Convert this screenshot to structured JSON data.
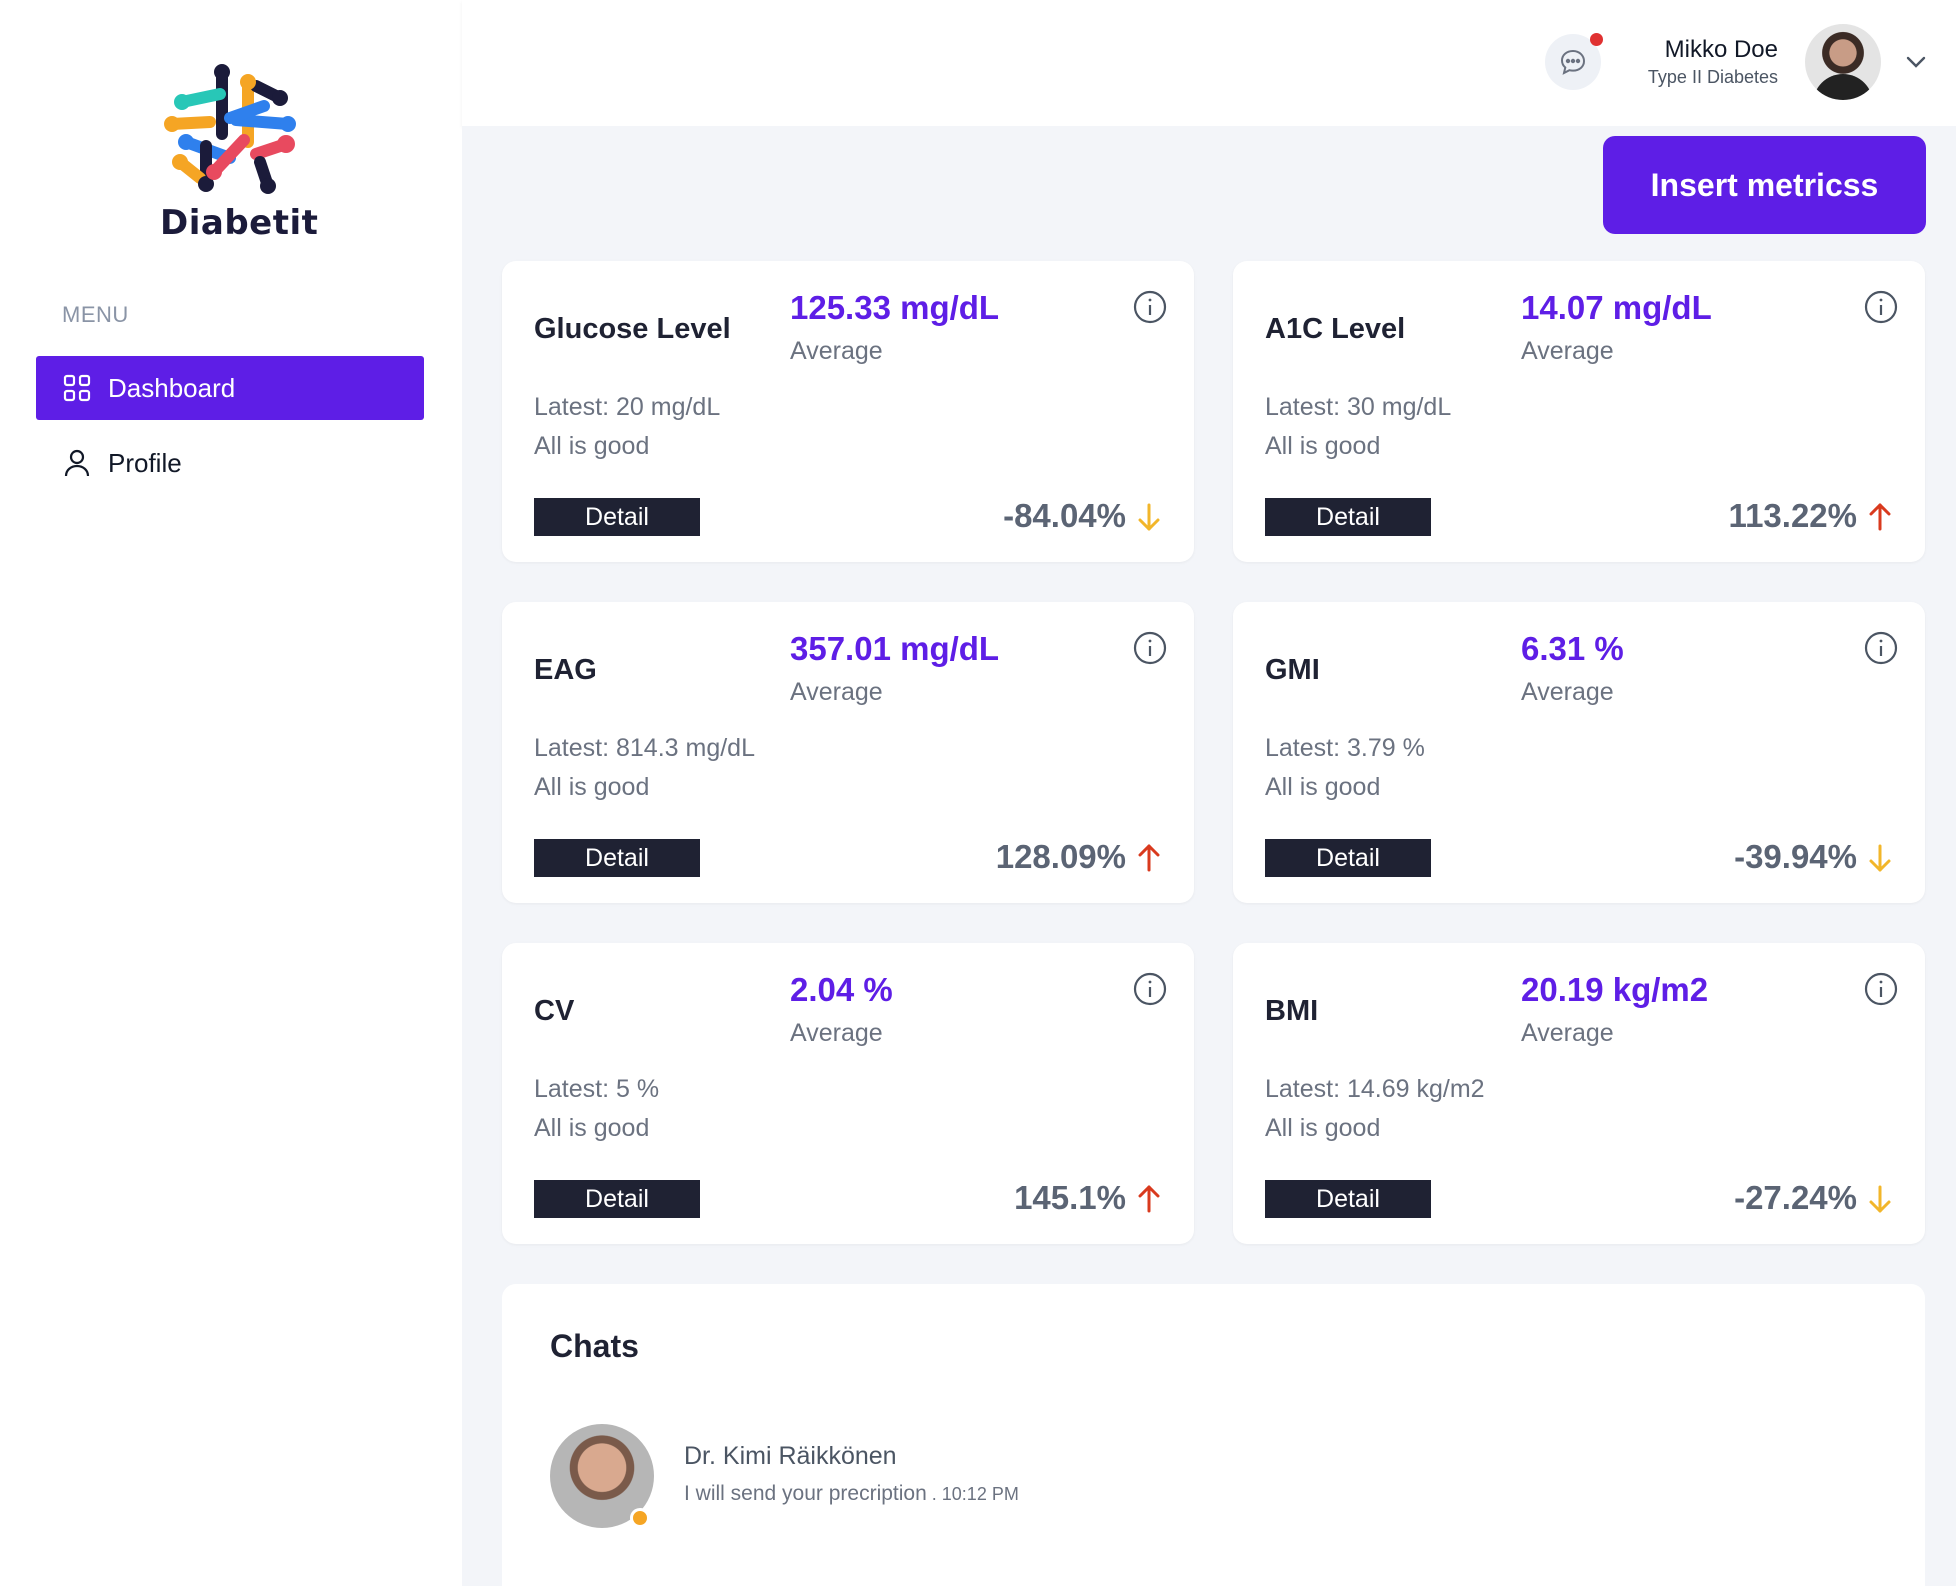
{
  "brand": {
    "name": "Diabetit"
  },
  "sidebar": {
    "menu_label": "MENU",
    "items": [
      {
        "label": "Dashboard",
        "icon": "grid-icon",
        "active": true
      },
      {
        "label": "Profile",
        "icon": "user-icon",
        "active": false
      }
    ]
  },
  "header": {
    "user_name": "Mikko Doe",
    "user_subtitle": "Type II Diabetes",
    "has_notification": true
  },
  "actions": {
    "insert_label": "Insert metricss"
  },
  "metrics": [
    {
      "title": "Glucose Level",
      "average": "125.33 mg/dL",
      "average_label": "Average",
      "latest": "Latest: 20 mg/dL",
      "status": "All is good",
      "detail_label": "Detail",
      "change": "-84.04%",
      "trend": "down"
    },
    {
      "title": "A1C Level",
      "average": "14.07 mg/dL",
      "average_label": "Average",
      "latest": "Latest: 30 mg/dL",
      "status": "All is good",
      "detail_label": "Detail",
      "change": "113.22%",
      "trend": "up"
    },
    {
      "title": "EAG",
      "average": "357.01 mg/dL",
      "average_label": "Average",
      "latest": "Latest: 814.3 mg/dL",
      "status": "All is good",
      "detail_label": "Detail",
      "change": "128.09%",
      "trend": "up"
    },
    {
      "title": "GMI",
      "average": "6.31 %",
      "average_label": "Average",
      "latest": "Latest: 3.79 %",
      "status": "All is good",
      "detail_label": "Detail",
      "change": "-39.94%",
      "trend": "down"
    },
    {
      "title": "CV",
      "average": "2.04 %",
      "average_label": "Average",
      "latest": "Latest: 5 %",
      "status": "All is good",
      "detail_label": "Detail",
      "change": "145.1%",
      "trend": "up"
    },
    {
      "title": "BMI",
      "average": "20.19 kg/m2",
      "average_label": "Average",
      "latest": "Latest: 14.69 kg/m2",
      "status": "All is good",
      "detail_label": "Detail",
      "change": "-27.24%",
      "trend": "down"
    }
  ],
  "chats": {
    "title": "Chats",
    "items": [
      {
        "name": "Dr. Kimi Räikkönen",
        "message": "I will send your precription",
        "time": " . 10:12 PM",
        "status_color": "#f5a524"
      }
    ]
  },
  "colors": {
    "accent": "#5e1ee6",
    "trend_up": "#d93a1e",
    "trend_down": "#f2b62a",
    "detail_button": "#1f2233"
  }
}
